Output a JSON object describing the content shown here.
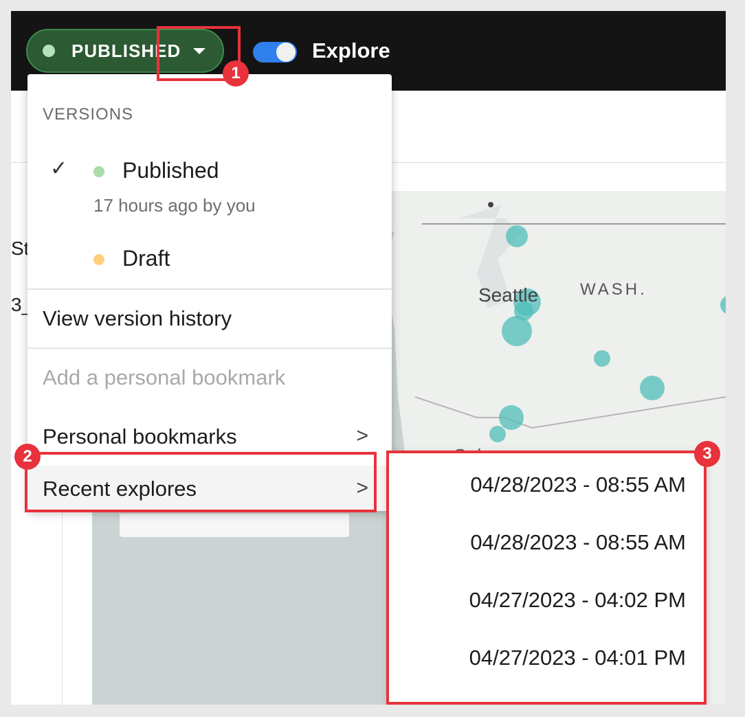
{
  "topbar": {
    "status_label": "PUBLISHED",
    "explore_label": "Explore",
    "explore_enabled": true
  },
  "background": {
    "left_text_1": "St",
    "left_text_2": "3_",
    "map": {
      "labels": {
        "city_1": "Seattle",
        "state": "WASH.",
        "city_2": "Salem"
      }
    }
  },
  "menu": {
    "heading": "VERSIONS",
    "versions": [
      {
        "label": "Published",
        "subtitle": "17 hours ago by you",
        "selected": true,
        "dot_color": "#a9dca8"
      },
      {
        "label": "Draft",
        "dot_color": "#ffcf7a"
      }
    ],
    "items": [
      {
        "label": "View version history"
      },
      {
        "label": "Add a personal bookmark",
        "disabled": true
      },
      {
        "label": "Personal bookmarks",
        "chevron": ">"
      },
      {
        "label": "Recent explores",
        "chevron": ">"
      }
    ]
  },
  "submenu": {
    "items": [
      "04/28/2023 - 08:55 AM",
      "04/28/2023 - 08:55 AM",
      "04/27/2023 - 04:02 PM",
      "04/27/2023 - 04:01 PM"
    ]
  },
  "callouts": [
    "1",
    "2",
    "3"
  ],
  "colors": {
    "accent_red": "#e8323c",
    "published_green": "#2b5a33",
    "toggle_blue": "#2f80ed",
    "map_marker": "#4fbdb8"
  }
}
